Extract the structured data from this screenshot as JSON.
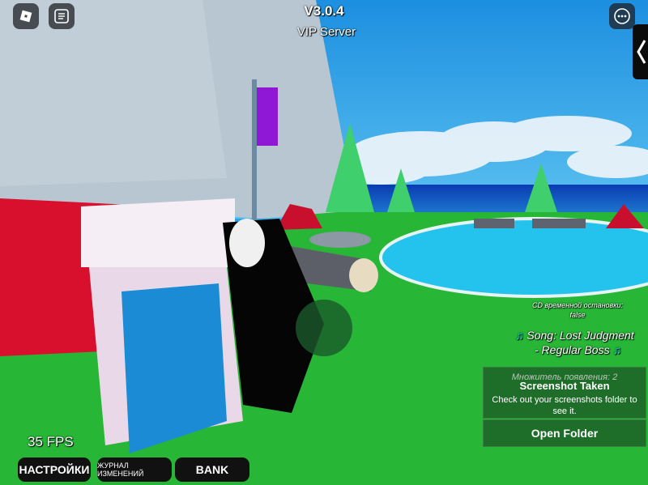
{
  "hud": {
    "version": "V3.0.4",
    "server": "VIP Server",
    "fps": "35 FPS"
  },
  "cooldown": {
    "label": "CD временной остановки:",
    "value": "false"
  },
  "song": {
    "line1": "Song: Lost Judgment",
    "line2": "- Regular Boss"
  },
  "spawn_multiplier": "Множитель появления: 2",
  "notification": {
    "title": "Screenshot Taken",
    "body": "Check out your screenshots folder to see it.",
    "button": "Open Folder"
  },
  "bottom_buttons": {
    "settings": "НАСТРОЙКИ",
    "changelog": "ЖУРНАЛ ИЗМЕНЕНИЙ",
    "bank": "BANK"
  },
  "colors": {
    "sky": "#2fa1e0",
    "grass": "#27b636",
    "notification_bg": "#1e6e2a",
    "button_bg": "#111111",
    "flag": "#8f17d6"
  },
  "icons": [
    "roblox-logo-icon",
    "chat-menu-icon",
    "more-options-icon",
    "collapse-arrow-icon",
    "music-note-icon"
  ]
}
